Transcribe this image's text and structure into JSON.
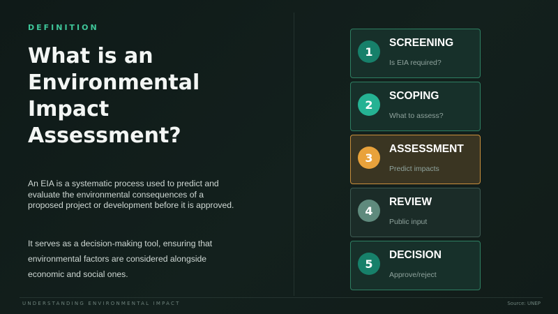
{
  "header": {
    "label": "DEFINITION",
    "title": "What is an Environmental Impact Assessment?"
  },
  "body": {
    "paragraph_1": "An EIA is a systematic process used to predict and evaluate the environmental consequences of a proposed project or development before it is approved.",
    "paragraph_2": "It serves as a decision-making tool, ensuring that environmental factors are considered alongside economic and social ones."
  },
  "steps": [
    {
      "number": "1",
      "title": "SCREENING",
      "subtitle": "Is EIA required?",
      "badge_color": "#17806a",
      "state": "default"
    },
    {
      "number": "2",
      "title": "SCOPING",
      "subtitle": "What to assess?",
      "badge_color": "#25b293",
      "state": "default"
    },
    {
      "number": "3",
      "title": "ASSESSMENT",
      "subtitle": "Predict impacts",
      "badge_color": "#e9a23b",
      "state": "active"
    },
    {
      "number": "4",
      "title": "REVIEW",
      "subtitle": "Public input",
      "badge_color": "#5f8a7d",
      "state": "muted"
    },
    {
      "number": "5",
      "title": "DECISION",
      "subtitle": "Approve/reject",
      "badge_color": "#17806a",
      "state": "default"
    }
  ],
  "footer": {
    "left": "UNDERSTANDING ENVIRONMENTAL IMPACT",
    "right": "Source: UNEP"
  },
  "colors": {
    "accent": "#3fc79a",
    "background": "#111d1a",
    "highlight": "#e9a23b"
  }
}
